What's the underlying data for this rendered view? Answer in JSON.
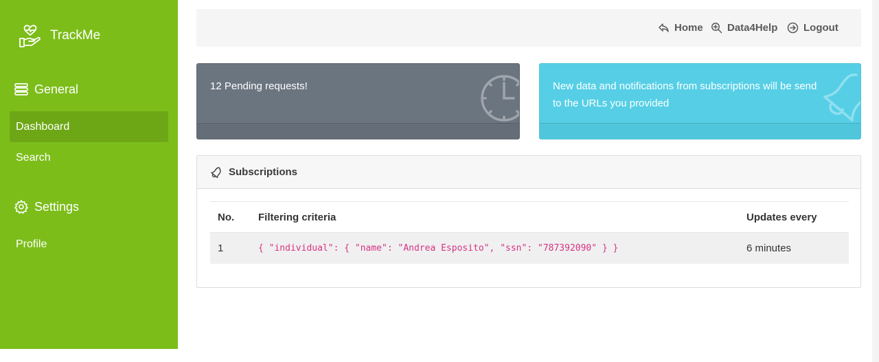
{
  "brand": {
    "name": "TrackMe",
    "icon": "heart-hand-icon"
  },
  "sidebar": {
    "sections": [
      {
        "label": "General",
        "icon": "list-icon"
      },
      {
        "label": "Settings",
        "icon": "gear-icon"
      }
    ],
    "items": [
      {
        "label": "Dashboard",
        "active": true
      },
      {
        "label": "Search",
        "active": false
      },
      {
        "label": "Profile",
        "active": false
      }
    ],
    "color": "#7cbd1a"
  },
  "topnav": {
    "links": [
      {
        "label": "Home",
        "icon": "reply-arrow-icon"
      },
      {
        "label": "Data4Help",
        "icon": "zoom-in-icon"
      },
      {
        "label": "Logout",
        "icon": "arrow-circle-right-icon"
      }
    ]
  },
  "cards": {
    "pending": {
      "text": "12 Pending requests!",
      "icon": "clock-icon",
      "color": "#6b7580"
    },
    "notify": {
      "text": "New data and notifications from subscriptions will be send to the URLs you provided",
      "icon": "bell-icon",
      "color": "#56cfe6"
    }
  },
  "subscriptions": {
    "title": "Subscriptions",
    "icon": "bell-icon",
    "headers": [
      "No.",
      "Filtering criteria",
      "Updates every"
    ],
    "rows": [
      {
        "no": "1",
        "criteria": "{ \"individual\": { \"name\": \"Andrea Esposito\", \"ssn\": \"787392090\" } }",
        "updates": "6 minutes"
      }
    ]
  }
}
